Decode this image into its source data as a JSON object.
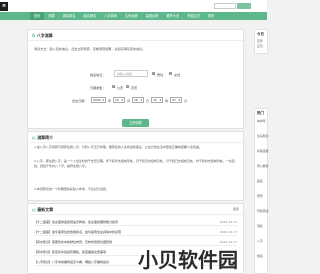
{
  "header": {
    "logo_text": "n",
    "search_button_label": "",
    "search_placeholder": ""
  },
  "nav": [
    "首页",
    "测算",
    "周易取名",
    "起名解名",
    "八字算命",
    "生肖运势",
    "星座运势",
    "解梦大全",
    "黄道吉日",
    "更多"
  ],
  "tool": {
    "title_prefix": "G",
    "title": "八字测算",
    "intro": "测试方法：输入您的信息，点击立即测算，查看测算结果，请如实填写您的信息。",
    "name_label": "姓名信息：",
    "name_placeholder": "请输入姓名",
    "gender_male": "男性",
    "gender_female": "女性",
    "calendar_label": "日期类型：",
    "calendar_solar": "公历",
    "calendar_lunar": "农历",
    "birth_label": "出生日期：",
    "year": "2000",
    "year_unit": "年",
    "month": "10",
    "month_unit": "月",
    "day": "18",
    "day_unit": "日",
    "hour": "10",
    "hour_unit": "时",
    "minute": "37",
    "minute_unit": "分",
    "submit": "立即测算"
  },
  "about": {
    "title": "测算简介",
    "p1": "1.最八字八字测算可测算生辰八字，分析八字五行命理，推算您的人生命运和事业，让在日常生活中更加正确地把握人生机遇。",
    "p2": "2.八字，即生辰八字，是一个人出生时的干支历日期。年干和年支组成年柱，月干和月支组成月柱，日干和日支组成日柱，时干和时支组成时柱，一共四柱，四柱干支共八个字，故称生辰八字。",
    "p3": "3.本测算仅供一个时期里的某些人参考，不必过分当真。"
  },
  "latest": {
    "title": "最新文章",
    "more": "更多",
    "items": [
      {
        "title": "【十二星座】处女座的金钱观是怎样的，处女座的理财能力如何",
        "date": "2024-10-17"
      },
      {
        "title": "【十二星座】金牛座男生的性格特点，金牛座男生在感情中的表现",
        "date": "2024-10-17"
      },
      {
        "title": "【风水知识】家居风水中的财位布局，怎样布置财位更旺财",
        "date": "2024-10-17"
      },
      {
        "title": "【风水知识】卧室风水禁忌有哪些，卧室摆放注意事项",
        "date": "2024-10-17"
      },
      {
        "title": "【八字知识】八字中的偏财运怎么看，哪些八字偏财运好",
        "date": "2024-10-17"
      }
    ]
  },
  "sidebar": {
    "head1": "今日",
    "head1_sub": "农历",
    "head1_sub2": "正月",
    "head2": "热门",
    "items": [
      "本命年",
      "生肖配对",
      "星座运势",
      "周公解梦",
      "起名",
      "黄历",
      "号码测试",
      "测名",
      "八字",
      "姓名"
    ]
  },
  "watermark": {
    "text": "小贝软件园"
  }
}
